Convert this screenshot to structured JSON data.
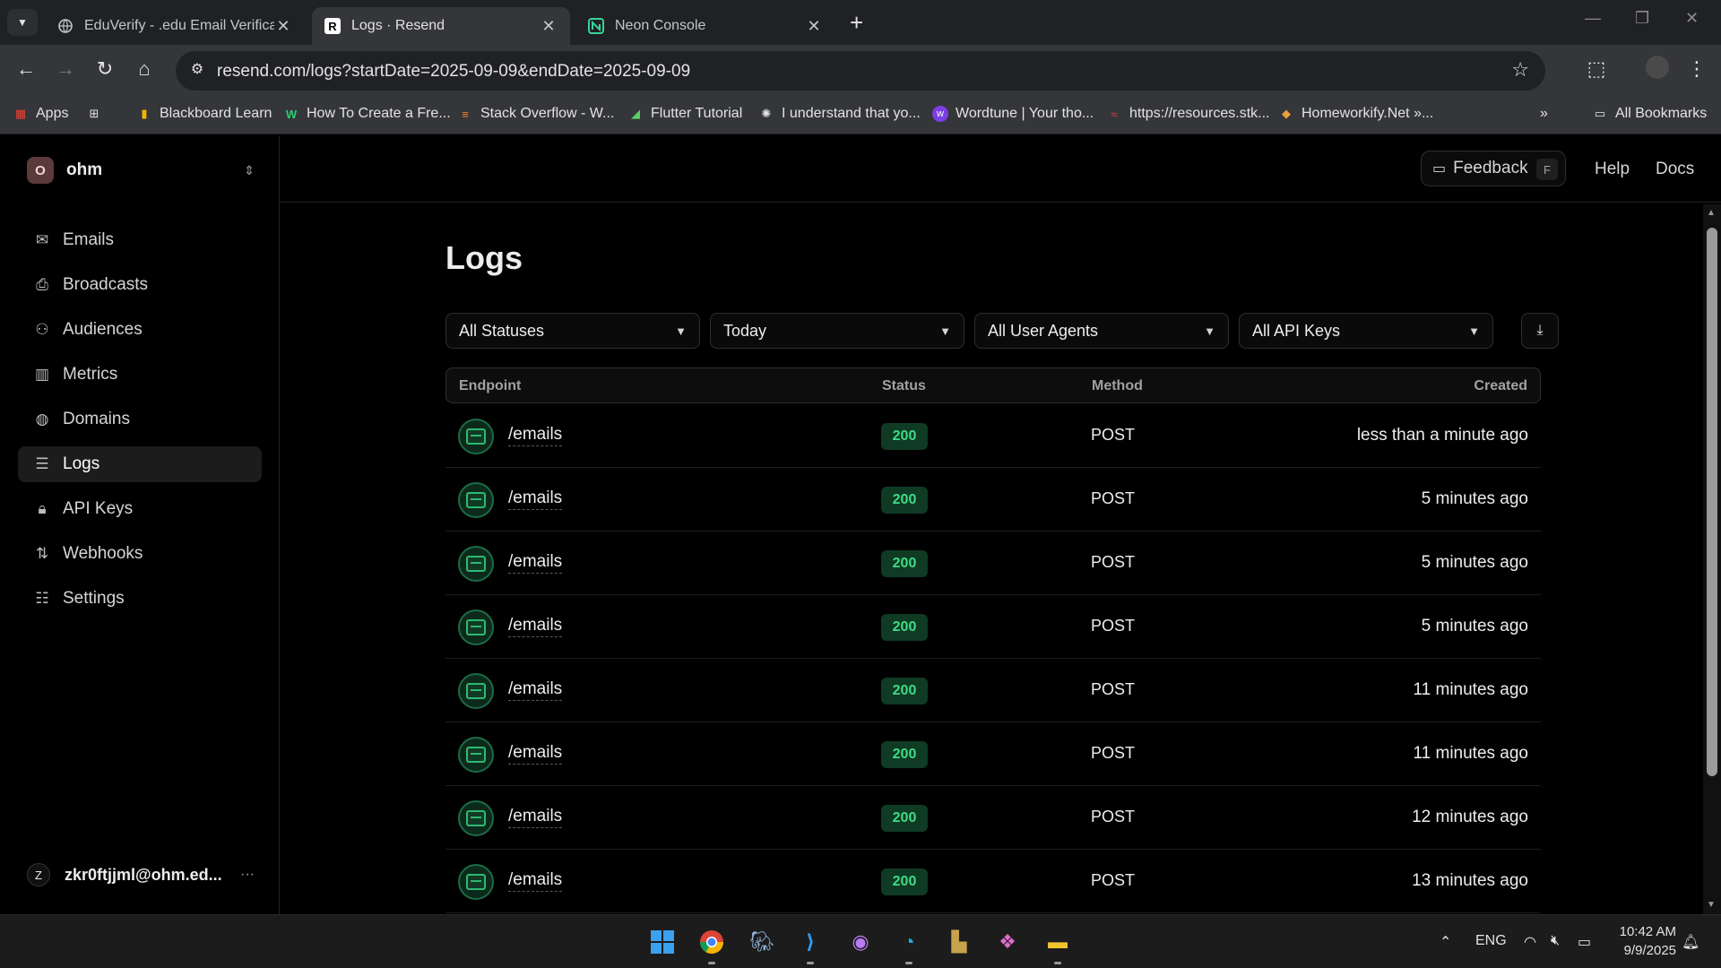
{
  "browser": {
    "tabs": [
      {
        "title": "EduVerify - .edu Email Verificatio",
        "icon": "globe-icon"
      },
      {
        "title": "Logs · Resend",
        "icon": "resend-icon"
      },
      {
        "title": "Neon Console",
        "icon": "neon-icon"
      }
    ],
    "url": "resend.com/logs?startDate=2025-09-09&endDate=2025-09-09",
    "bookmarks": [
      {
        "label": "Apps",
        "icon": "apps-grid-icon"
      },
      {
        "label": "Blackboard Learn",
        "icon": "blackboard-icon"
      },
      {
        "label": "How To Create a Fre...",
        "icon": "w-icon"
      },
      {
        "label": "Stack Overflow - W...",
        "icon": "stackoverflow-icon"
      },
      {
        "label": "Flutter Tutorial",
        "icon": "flutter-icon"
      },
      {
        "label": "I understand that yo...",
        "icon": "openai-icon"
      },
      {
        "label": "Wordtune | Your tho...",
        "icon": "wordtune-icon"
      },
      {
        "label": "https://resources.stk...",
        "icon": "stk-icon"
      },
      {
        "label": "Homeworkify.Net »...",
        "icon": "homeworkify-icon"
      }
    ],
    "all_bookmarks": "All Bookmarks"
  },
  "sidebar": {
    "team": {
      "initial": "O",
      "name": "ohm"
    },
    "items": [
      {
        "label": "Emails",
        "icon": "mail-icon"
      },
      {
        "label": "Broadcasts",
        "icon": "inbox-icon"
      },
      {
        "label": "Audiences",
        "icon": "users-icon"
      },
      {
        "label": "Metrics",
        "icon": "bar-chart-icon"
      },
      {
        "label": "Domains",
        "icon": "globe-icon"
      },
      {
        "label": "Logs",
        "icon": "list-icon"
      },
      {
        "label": "API Keys",
        "icon": "lock-icon"
      },
      {
        "label": "Webhooks",
        "icon": "webhook-icon"
      },
      {
        "label": "Settings",
        "icon": "sliders-icon"
      }
    ],
    "active": "Logs",
    "user": {
      "initial": "Z",
      "email": "zkr0ftjjml@ohm.ed...",
      "more": "···"
    }
  },
  "topbar": {
    "feedback": "Feedback",
    "feedback_key": "F",
    "help": "Help",
    "docs": "Docs"
  },
  "main": {
    "title": "Logs",
    "filters": [
      "All Statuses",
      "Today",
      "All User Agents",
      "All API Keys"
    ],
    "columns": {
      "endpoint": "Endpoint",
      "status": "Status",
      "method": "Method",
      "created": "Created"
    },
    "rows": [
      {
        "endpoint": "/emails",
        "status": "200",
        "method": "POST",
        "created": "less than a minute ago"
      },
      {
        "endpoint": "/emails",
        "status": "200",
        "method": "POST",
        "created": "5 minutes ago"
      },
      {
        "endpoint": "/emails",
        "status": "200",
        "method": "POST",
        "created": "5 minutes ago"
      },
      {
        "endpoint": "/emails",
        "status": "200",
        "method": "POST",
        "created": "5 minutes ago"
      },
      {
        "endpoint": "/emails",
        "status": "200",
        "method": "POST",
        "created": "11 minutes ago"
      },
      {
        "endpoint": "/emails",
        "status": "200",
        "method": "POST",
        "created": "11 minutes ago"
      },
      {
        "endpoint": "/emails",
        "status": "200",
        "method": "POST",
        "created": "12 minutes ago"
      },
      {
        "endpoint": "/emails",
        "status": "200",
        "method": "POST",
        "created": "13 minutes ago"
      }
    ]
  },
  "taskbar": {
    "language": "ENG",
    "time": "10:42 AM",
    "date": "9/9/2025"
  },
  "colors": {
    "accent_green": "#3ddc84",
    "badge_bg": "#0f3a24",
    "background": "#000000"
  }
}
